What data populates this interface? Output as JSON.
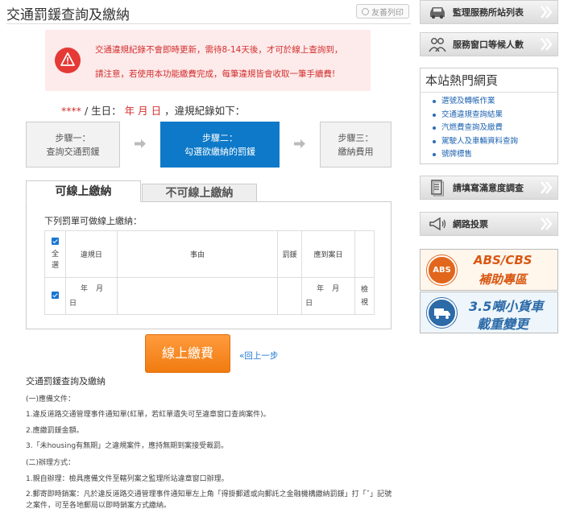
{
  "page": {
    "title": "交通罰鍰查詢及繳納",
    "print_label": "友善列印"
  },
  "alert": {
    "line1": "交通違規紀錄不會即時更新，需待8-14天後，才可於線上查詢到，",
    "line2": "請注意，若使用本功能繳費完成，每筆違規皆會收取一筆手續費!"
  },
  "info": {
    "masked_id": "****",
    "birthday_label": "/ 生日：",
    "birthday_value": "年 月 日",
    "suffix": "，違規紀錄如下："
  },
  "steps": [
    {
      "line1": "步驟一：",
      "line2": "查詢交通罰鍰"
    },
    {
      "line1": "步驟二：",
      "line2": "勾選欲繳納的罰鍰"
    },
    {
      "line1": "步驟三：",
      "line2": "繳納費用"
    }
  ],
  "tabs": {
    "online": "可線上繳納",
    "offline": "不可線上繳納"
  },
  "fines": {
    "caption": "下列罰單可做線上繳納：",
    "headers": {
      "select_all_1": "全",
      "select_all_2": "選",
      "violation_date": "違規日",
      "reason": "事由",
      "amount": "罰鍰",
      "due_date": "應到案日"
    },
    "rows": [
      {
        "violation_ym": "年月",
        "violation_d": "日",
        "reason": "",
        "amount": "",
        "due_ym": "年月",
        "due_d": "日",
        "detail_1": "檢",
        "detail_2": "視"
      }
    ]
  },
  "actions": {
    "pay_label": "線上繳費",
    "back_label": "«回上一步"
  },
  "guide": {
    "title": "交通罰鍰查詢及繳納",
    "lines": [
      "(一)應備文件：",
      "1.違反道路交通管理事件通知單(紅單，若紅單遺失可至違章窗口查詢案件)。",
      "2.應繳罰鍰金額。",
      "3.「未housing有無期」之違規案件，應持無期到案接受裁罰。",
      "(二)辦理方式：",
      "1.親自辦理：檢具應備文件至轄列案之監理所站違章窗口辦理。",
      "2.郵寄即時銷案：凡於違反道路交通管理事件通知單左上角「得掛郵遞或向郵託之金融機構繳納罰鍰」打「ˇ」記號",
      "之案件，可至各地郵局以即時銷案方式繳納。"
    ]
  },
  "sidebar": {
    "station_list": "監理服務所站列表",
    "queue": "服務窗口等候人數",
    "hot_title": "本站熱門網頁",
    "hot_links": [
      "選號及轉帳作業",
      "交通違規查詢結果",
      "汽燃費查詢及繳費",
      "駕駛人及車輛資料查詢",
      "號牌標售"
    ],
    "survey": "請填寫滿意度調查",
    "vote": "網路投票",
    "abs_badge": "ABS",
    "abs_line1": "ABS/CBS",
    "abs_line2": "補助專區",
    "truck_line1": "3.5噸小貨車",
    "truck_line2": "載重變更"
  },
  "colors": {
    "accent_blue": "#0d79c8",
    "alert_red": "#d32f2f",
    "pay_orange": "#f07b10",
    "link_blue": "#1e63b0"
  }
}
